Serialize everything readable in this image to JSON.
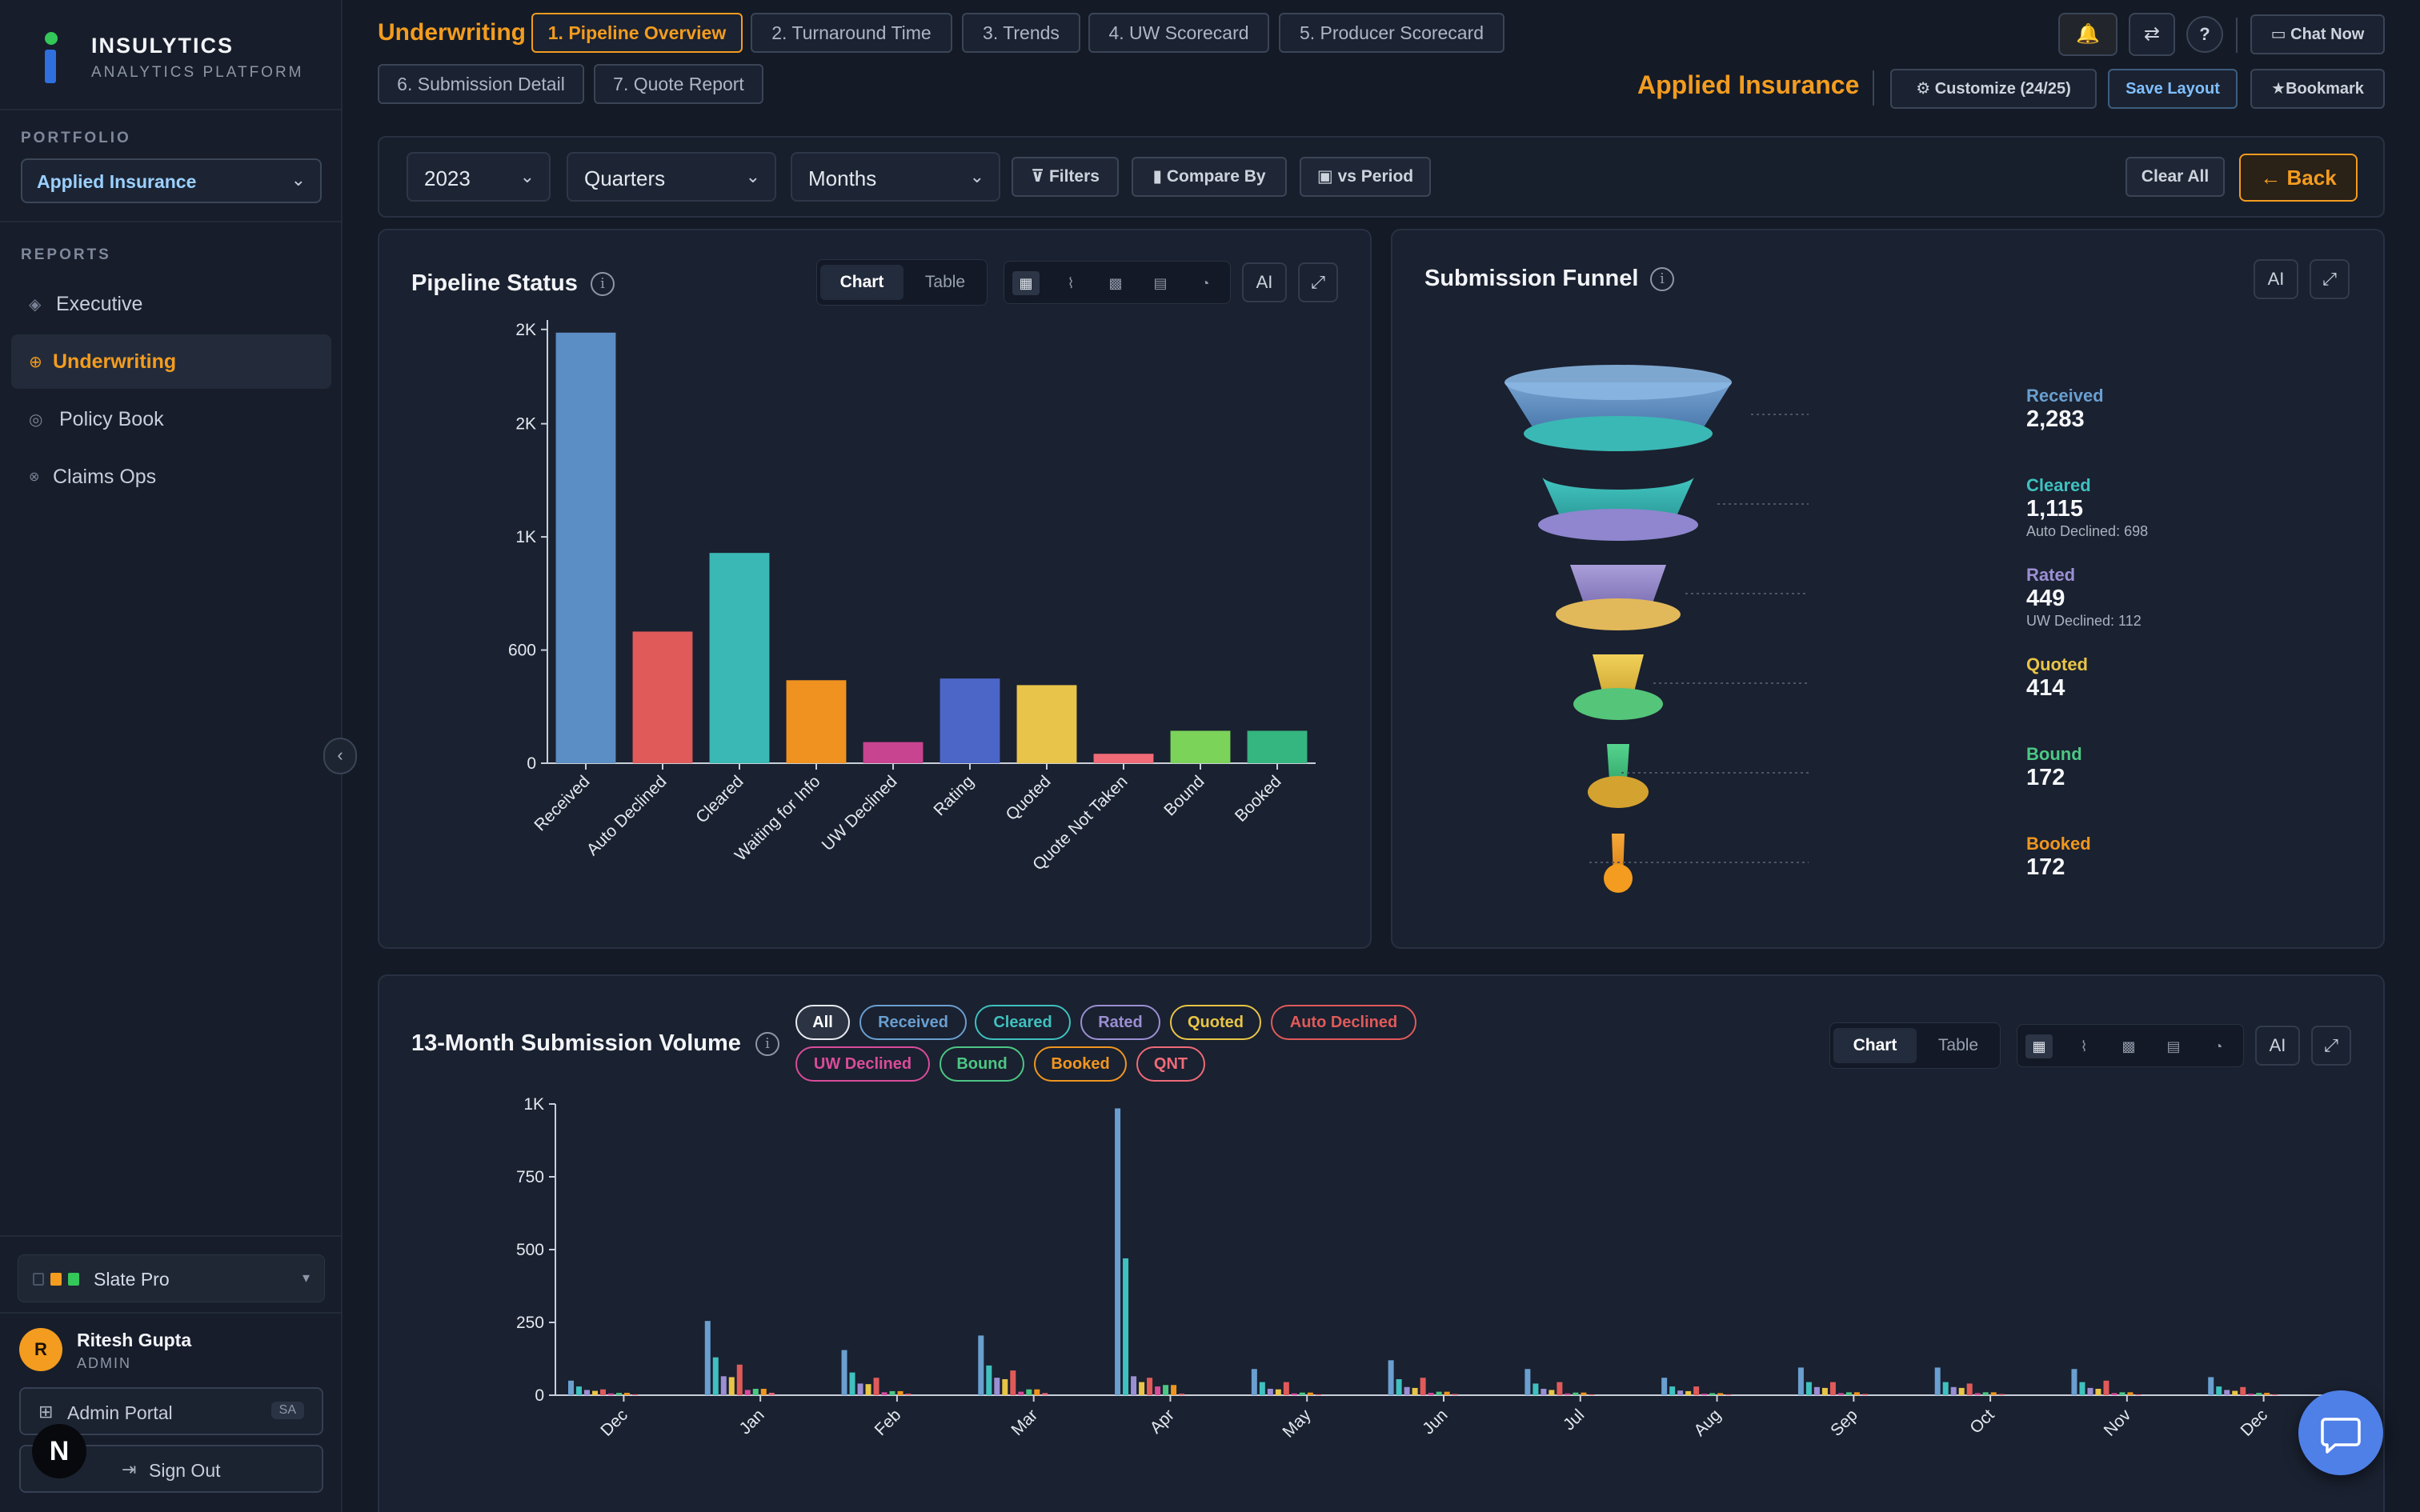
{
  "app": {
    "name": "INSULYTICS",
    "tagline": "ANALYTICS PLATFORM"
  },
  "sidebar": {
    "portfolio_label": "PORTFOLIO",
    "portfolio_value": "Applied Insurance",
    "reports_label": "REPORTS",
    "items": [
      {
        "label": "Executive",
        "icon": "diamond-icon"
      },
      {
        "label": "Underwriting",
        "icon": "target-icon",
        "active": true
      },
      {
        "label": "Policy Book",
        "icon": "circle-icon"
      },
      {
        "label": "Claims Ops",
        "icon": "asterisk-icon"
      }
    ],
    "theme": {
      "label": "Slate Pro",
      "swatches": [
        "#2c3546",
        "#f39c1f",
        "#34c759"
      ]
    },
    "user": {
      "initial": "R",
      "name": "Ritesh Gupta",
      "role": "ADMIN"
    },
    "admin_portal": {
      "label": "Admin Portal",
      "tag": "SA"
    },
    "sign_out": "Sign Out",
    "n_badge": "N"
  },
  "header": {
    "section": "Underwriting",
    "tabs": [
      "1. Pipeline Overview",
      "2. Turnaround Time",
      "3. Trends",
      "4. UW Scorecard",
      "5. Producer Scorecard",
      "6. Submission Detail",
      "7. Quote Report"
    ],
    "active_tab": 0,
    "chat_now": "Chat Now",
    "brand": "Applied Insurance",
    "customize": "Customize (24/25)",
    "save_layout": "Save Layout",
    "bookmark": "Bookmark"
  },
  "filters": {
    "year": "2023",
    "quarters": "Quarters",
    "months": "Months",
    "filters_btn": "Filters",
    "compare_btn": "Compare By",
    "period_btn": "vs Period",
    "clear_all": "Clear All",
    "back": "← Back"
  },
  "pipeline": {
    "title": "Pipeline Status",
    "view_chart": "Chart",
    "view_table": "Table",
    "ai": "AI"
  },
  "funnel": {
    "title": "Submission Funnel",
    "ai": "AI",
    "stages": [
      {
        "name": "Received",
        "value": "2,283",
        "color": "#6a9fd0"
      },
      {
        "name": "Cleared",
        "value": "1,115",
        "note": "Auto Declined: 698",
        "color": "#3fc1bf"
      },
      {
        "name": "Rated",
        "value": "449",
        "note": "UW Declined: 112",
        "color": "#9b8fd3"
      },
      {
        "name": "Quoted",
        "value": "414",
        "color": "#e8c547"
      },
      {
        "name": "Bound",
        "value": "172",
        "color": "#4cc784"
      },
      {
        "name": "Booked",
        "value": "172",
        "color": "#f0961f"
      }
    ]
  },
  "volume": {
    "title": "13-Month Submission Volume",
    "view_chart": "Chart",
    "view_table": "Table",
    "ai": "AI",
    "chips": [
      {
        "label": "All",
        "color": "#e8ebf0"
      },
      {
        "label": "Received",
        "color": "#6a9fd0"
      },
      {
        "label": "Cleared",
        "color": "#3fc1bf"
      },
      {
        "label": "Rated",
        "color": "#9b8fd3"
      },
      {
        "label": "Quoted",
        "color": "#e8c547"
      },
      {
        "label": "Auto Declined",
        "color": "#e05a5a"
      },
      {
        "label": "UW Declined",
        "color": "#d94c9a"
      },
      {
        "label": "Bound",
        "color": "#4cc784"
      },
      {
        "label": "Booked",
        "color": "#f0961f"
      },
      {
        "label": "QNT",
        "color": "#f06a78"
      }
    ]
  },
  "chart_data": [
    {
      "type": "bar",
      "categories": [
        "Received",
        "Auto Declined",
        "Cleared",
        "Waiting for Info",
        "UW Declined",
        "Rating",
        "Quoted",
        "Quote Not Taken",
        "Bound",
        "Booked"
      ],
      "values": [
        2283,
        698,
        1115,
        440,
        112,
        449,
        414,
        50,
        172,
        172
      ],
      "colors": [
        "#5b8ec4",
        "#e05a5a",
        "#3ab8b5",
        "#ef921f",
        "#c84490",
        "#4c66c8",
        "#e9c44a",
        "#f06a78",
        "#7bd35a",
        "#35b57f"
      ],
      "yticks": [
        {
          "value": 0,
          "label": "0"
        },
        {
          "value": 600,
          "label": "600"
        },
        {
          "value": 1200,
          "label": "1K"
        },
        {
          "value": 1800,
          "label": "2K"
        },
        {
          "value": 2300,
          "label": "2K"
        }
      ],
      "ylim": [
        0,
        2350
      ]
    },
    {
      "type": "bar",
      "categories": [
        "Dec",
        "Jan",
        "Feb",
        "Mar",
        "Apr",
        "May",
        "Jun",
        "Jul",
        "Aug",
        "Sep",
        "Oct",
        "Nov",
        "Dec"
      ],
      "series": [
        {
          "name": "Received",
          "color": "#6a9fd0",
          "values": [
            50,
            255,
            155,
            205,
            985,
            90,
            120,
            90,
            60,
            95,
            95,
            90,
            62
          ]
        },
        {
          "name": "Cleared",
          "color": "#3fc1bf",
          "values": [
            30,
            130,
            78,
            102,
            470,
            45,
            55,
            40,
            30,
            45,
            45,
            45,
            30
          ]
        },
        {
          "name": "Rated",
          "color": "#9b8fd3",
          "values": [
            18,
            65,
            40,
            60,
            65,
            22,
            28,
            22,
            16,
            28,
            28,
            25,
            18
          ]
        },
        {
          "name": "Quoted",
          "color": "#e8c547",
          "values": [
            15,
            62,
            38,
            55,
            45,
            20,
            25,
            18,
            14,
            25,
            25,
            22,
            15
          ]
        },
        {
          "name": "Auto Declined",
          "color": "#e05a5a",
          "values": [
            20,
            105,
            60,
            85,
            60,
            45,
            60,
            45,
            30,
            45,
            40,
            50,
            28
          ]
        },
        {
          "name": "UW Declined",
          "color": "#d94c9a",
          "values": [
            6,
            18,
            10,
            12,
            30,
            6,
            8,
            6,
            5,
            7,
            7,
            7,
            5
          ]
        },
        {
          "name": "Bound",
          "color": "#4cc784",
          "values": [
            8,
            22,
            14,
            20,
            35,
            9,
            12,
            9,
            7,
            10,
            10,
            10,
            8
          ]
        },
        {
          "name": "Booked",
          "color": "#f0961f",
          "values": [
            8,
            22,
            14,
            20,
            35,
            9,
            12,
            9,
            7,
            10,
            10,
            10,
            8
          ]
        },
        {
          "name": "QNT",
          "color": "#f06a78",
          "values": [
            3,
            8,
            5,
            7,
            5,
            3,
            4,
            3,
            3,
            4,
            4,
            3,
            3
          ]
        }
      ],
      "yticks": [
        {
          "value": 0,
          "label": "0"
        },
        {
          "value": 250,
          "label": "250"
        },
        {
          "value": 500,
          "label": "500"
        },
        {
          "value": 750,
          "label": "750"
        },
        {
          "value": 1000,
          "label": "1K"
        }
      ],
      "ylim": [
        0,
        1000
      ]
    }
  ]
}
